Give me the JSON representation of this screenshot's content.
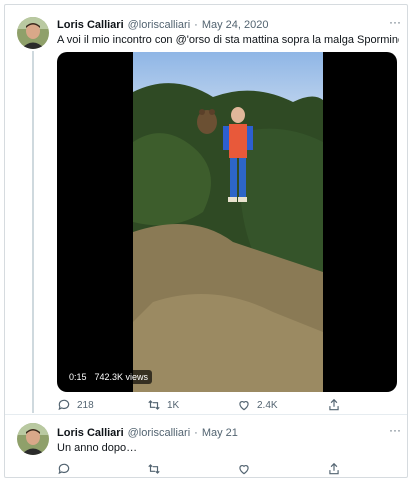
{
  "tweets": [
    {
      "author": "Loris Calliari",
      "handle": "@loriscalliari",
      "separator": "·",
      "date": "May 24, 2020",
      "text": "A voi il mio incontro con @'orso di sta mattina sopra la malga Sporminore…",
      "media": {
        "duration": "0:15",
        "views": "742.3K views"
      },
      "more": "···",
      "actions": {
        "replies": "218",
        "retweets": "1K",
        "likes": "2.4K"
      }
    },
    {
      "author": "Loris Calliari",
      "handle": "@loriscalliari",
      "separator": "·",
      "date": "May 21",
      "text": "Un anno dopo…",
      "more": "···",
      "actions": {
        "replies": "",
        "retweets": "",
        "likes": ""
      }
    }
  ],
  "icons": [
    "reply-icon",
    "retweet-icon",
    "like-icon",
    "share-icon",
    "more-icon"
  ]
}
